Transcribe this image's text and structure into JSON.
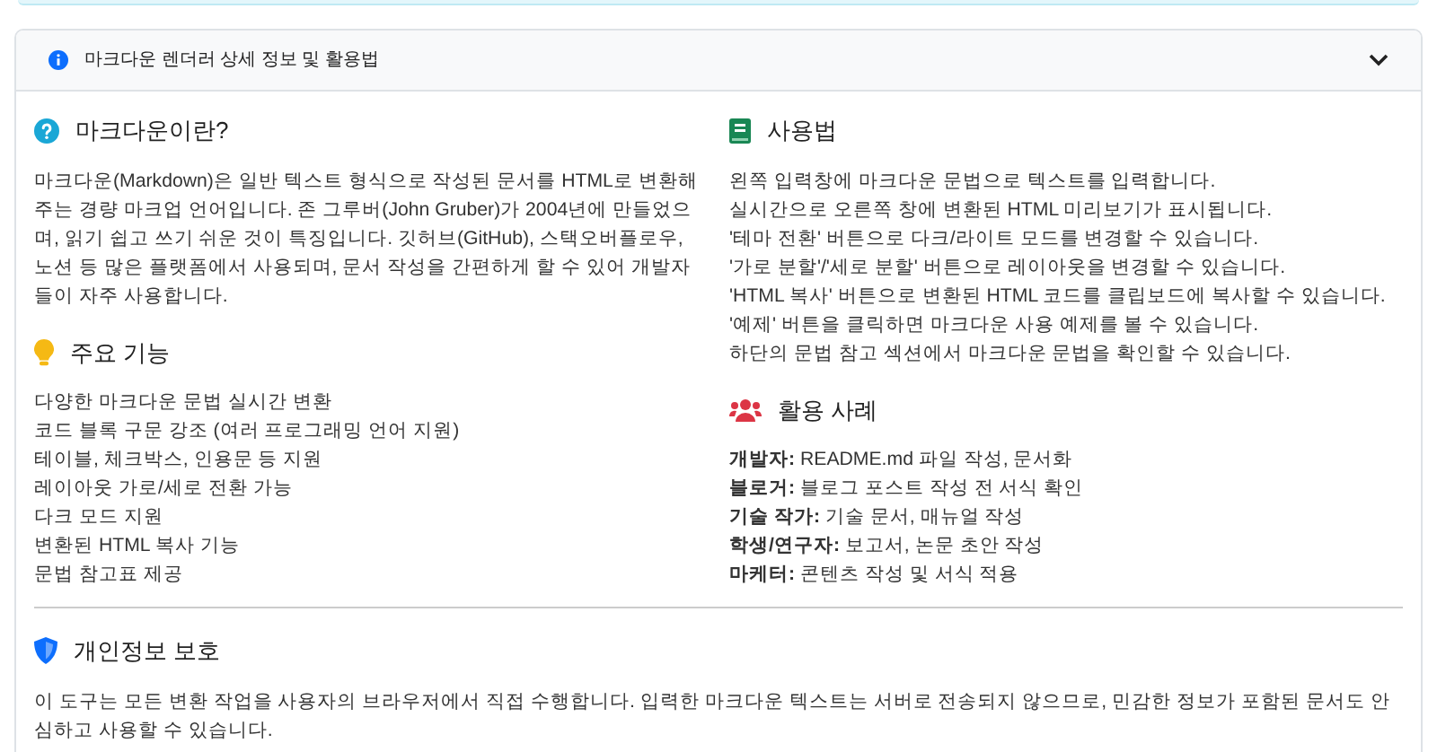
{
  "accordion": {
    "title": "마크다운 렌더러 상세 정보 및 활용법",
    "expanded": true
  },
  "columns": [
    {
      "sections": [
        {
          "kind": "paragraph",
          "title": "마크다운이란?",
          "text": "마크다운(Markdown)은 일반 텍스트 형식으로 작성된 문서를 HTML로 변환해주는 경량 마크업 언어입니다. 존 그루버(John Gruber)가 2004년에 만들었으며, 읽기 쉽고 쓰기 쉬운 것이 특징입니다. 깃허브(GitHub), 스택오버플로우, 노션 등 많은 플랫폼에서 사용되며, 문서 작성을 간편하게 할 수 있어 개발자들이 자주 사용합니다."
        },
        {
          "kind": "list",
          "title": "주요 기능",
          "items": [
            "다양한 마크다운 문법 실시간 변환",
            "코드 블록 구문 강조 (여러 프로그래밍 언어 지원)",
            "테이블, 체크박스, 인용문 등 지원",
            "레이아웃 가로/세로 전환 가능",
            "다크 모드 지원",
            "변환된 HTML 복사 기능",
            "문법 참고표 제공"
          ]
        }
      ]
    },
    {
      "sections": [
        {
          "kind": "list",
          "title": "사용법",
          "items": [
            "왼쪽 입력창에 마크다운 문법으로 텍스트를 입력합니다.",
            "실시간으로 오른쪽 창에 변환된 HTML 미리보기가 표시됩니다.",
            "'테마 전환' 버튼으로 다크/라이트 모드를 변경할 수 있습니다.",
            "'가로 분할'/'세로 분할' 버튼으로 레이아웃을 변경할 수 있습니다.",
            "'HTML 복사' 버튼으로 변환된 HTML 코드를 클립보드에 복사할 수 있습니다.",
            "'예제' 버튼을 클릭하면 마크다운 사용 예제를 볼 수 있습니다.",
            "하단의 문법 참고 섹션에서 마크다운 문법을 확인할 수 있습니다."
          ]
        },
        {
          "kind": "list",
          "title": "활용 사례",
          "items": [
            "**개발자:** README.md 파일 작성, 문서화",
            "**블로거:** 블로그 포스트 작성 전 서식 확인",
            "**기술 작가:** 기술 문서, 매뉴얼 작성",
            "**학생/연구자:** 보고서, 논문 초안 작성",
            "**마케터:** 콘텐츠 작성 및 서식 적용"
          ]
        }
      ]
    }
  ],
  "privacy": {
    "kind": "paragraph",
    "title": "개인정보 보호",
    "text": "이 도구는 모든 변환 작업을 사용자의 브라우저에서 직접 수행합니다. 입력한 마크다운 텍스트는 서버로 전송되지 않으므로, 민감한 정보가 포함된 문서도 안심하고 사용할 수 있습니다."
  }
}
